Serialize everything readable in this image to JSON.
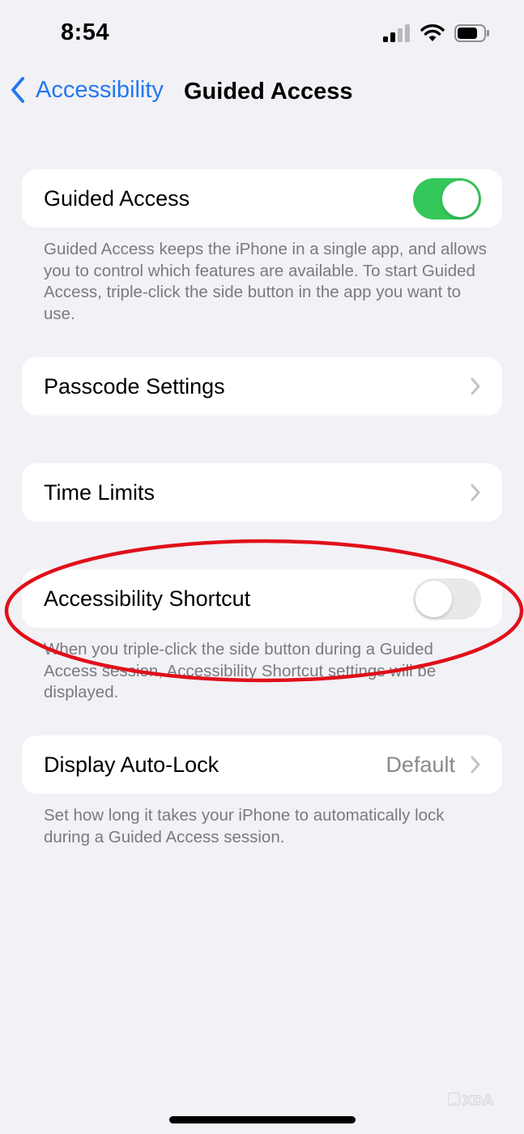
{
  "status_bar": {
    "time": "8:54",
    "signal_icon": "cellular-signal-icon",
    "wifi_icon": "wifi-icon",
    "battery_icon": "battery-icon"
  },
  "nav": {
    "back_label": "Accessibility",
    "back_icon": "chevron-left-icon",
    "title": "Guided Access",
    "accent_color": "#2378f0"
  },
  "settings": {
    "guided_access": {
      "label": "Guided Access",
      "enabled": true,
      "footnote": "Guided Access keeps the iPhone in a single app, and allows you to control which features are available. To start Guided Access, triple-click the side button in the app you want to use."
    },
    "passcode_settings": {
      "label": "Passcode Settings"
    },
    "time_limits": {
      "label": "Time Limits"
    },
    "accessibility_shortcut": {
      "label": "Accessibility Shortcut",
      "enabled": false,
      "footnote": "When you triple-click the side button during a Guided Access session, Accessibility Shortcut settings will be displayed."
    },
    "display_auto_lock": {
      "label": "Display Auto-Lock",
      "value": "Default",
      "footnote": "Set how long it takes your iPhone to automatically lock during a Guided Access session."
    }
  },
  "colors": {
    "toggle_on": "#34c759",
    "toggle_off": "#e9e9ea",
    "annotation": "#e0101a",
    "background": "#f2f1f6"
  },
  "watermark": {
    "text": "XDA"
  }
}
